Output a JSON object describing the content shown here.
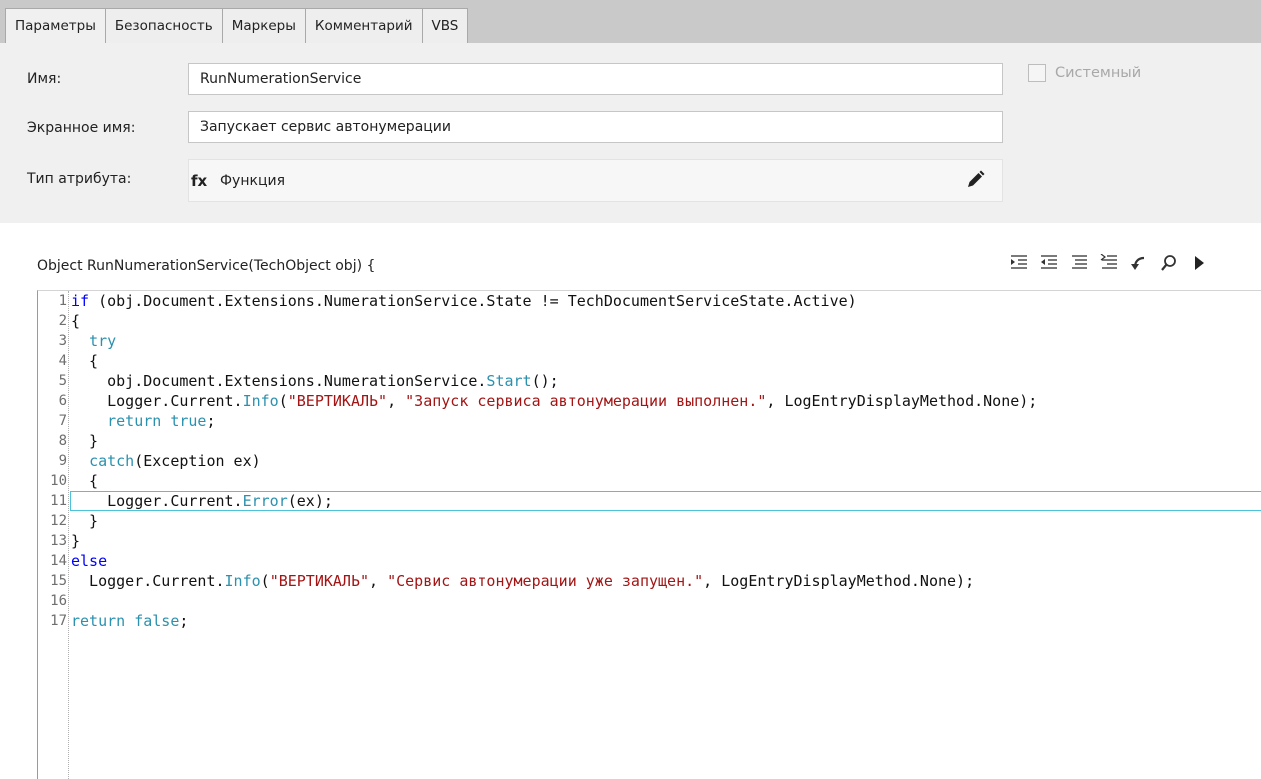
{
  "tabs": [
    {
      "label": "Параметры",
      "active": true
    },
    {
      "label": "Безопасность",
      "active": false
    },
    {
      "label": "Маркеры",
      "active": false
    },
    {
      "label": "Комментарий",
      "active": false
    },
    {
      "label": "VBS",
      "active": false
    }
  ],
  "form": {
    "name_label": "Имя:",
    "name_value": "RunNumerationService",
    "display_label": "Экранное имя:",
    "display_value": "Запускает сервис автонумерации",
    "type_label": "Тип атрибута:",
    "type_icon": "fx",
    "type_value": "Функция",
    "system_label": "Системный",
    "system_checked": false
  },
  "code": {
    "signature": "Object RunNumerationService(TechObject obj) {",
    "current_line": 9,
    "lines": [
      {
        "n": "1",
        "parts": [
          {
            "k": "kw",
            "t": "if"
          },
          {
            "k": "",
            "t": " (obj.Document.Extensions.NumerationService.State != TechDocumentServiceState.Active)"
          }
        ]
      },
      {
        "n": "2",
        "parts": [
          {
            "k": "",
            "t": "{"
          }
        ]
      },
      {
        "n": "3",
        "parts": [
          {
            "k": "",
            "t": "  "
          },
          {
            "k": "fn",
            "t": "try"
          }
        ]
      },
      {
        "n": "4",
        "parts": [
          {
            "k": "",
            "t": "  {"
          }
        ]
      },
      {
        "n": "5",
        "parts": [
          {
            "k": "",
            "t": "    obj.Document.Extensions.NumerationService."
          },
          {
            "k": "fn",
            "t": "Start"
          },
          {
            "k": "",
            "t": "();"
          }
        ]
      },
      {
        "n": "6",
        "parts": [
          {
            "k": "",
            "t": "    Logger.Current."
          },
          {
            "k": "fn",
            "t": "Info"
          },
          {
            "k": "",
            "t": "("
          },
          {
            "k": "st",
            "t": "\"ВЕРТИКАЛЬ\""
          },
          {
            "k": "",
            "t": ", "
          },
          {
            "k": "st",
            "t": "\"Запуск сервиса автонумерации выполнен.\""
          },
          {
            "k": "",
            "t": ", LogEntryDisplayMethod.None);"
          }
        ]
      },
      {
        "n": "7",
        "parts": [
          {
            "k": "",
            "t": "    "
          },
          {
            "k": "fn",
            "t": "return"
          },
          {
            "k": "",
            "t": " "
          },
          {
            "k": "fn",
            "t": "true"
          },
          {
            "k": "",
            "t": ";"
          }
        ]
      },
      {
        "n": "8",
        "parts": [
          {
            "k": "",
            "t": "  }"
          }
        ]
      },
      {
        "n": "9",
        "parts": [
          {
            "k": "",
            "t": "  "
          },
          {
            "k": "fn",
            "t": "catch"
          },
          {
            "k": "",
            "t": "(Exception ex)"
          }
        ]
      },
      {
        "n": "10",
        "parts": [
          {
            "k": "",
            "t": "  {"
          }
        ]
      },
      {
        "n": "11",
        "parts": [
          {
            "k": "",
            "t": "    Logger.Current."
          },
          {
            "k": "fn",
            "t": "Error"
          },
          {
            "k": "",
            "t": "(ex);"
          }
        ]
      },
      {
        "n": "12",
        "parts": [
          {
            "k": "",
            "t": "  }"
          }
        ]
      },
      {
        "n": "13",
        "parts": [
          {
            "k": "",
            "t": "}"
          }
        ]
      },
      {
        "n": "14",
        "parts": [
          {
            "k": "kw",
            "t": "else"
          }
        ]
      },
      {
        "n": "15",
        "parts": [
          {
            "k": "",
            "t": "  Logger.Current."
          },
          {
            "k": "fn",
            "t": "Info"
          },
          {
            "k": "",
            "t": "("
          },
          {
            "k": "st",
            "t": "\"ВЕРТИКАЛЬ\""
          },
          {
            "k": "",
            "t": ", "
          },
          {
            "k": "st",
            "t": "\"Сервис автонумерации уже запущен.\""
          },
          {
            "k": "",
            "t": ", LogEntryDisplayMethod.None);"
          }
        ]
      },
      {
        "n": "16",
        "parts": []
      },
      {
        "n": "17",
        "parts": [
          {
            "k": "fn",
            "t": "return"
          },
          {
            "k": "",
            "t": " "
          },
          {
            "k": "fn",
            "t": "false"
          },
          {
            "k": "",
            "t": ";"
          }
        ]
      }
    ]
  },
  "toolbar_icons": [
    "indent-icon",
    "outdent-icon",
    "comment-lines-icon",
    "uncomment-lines-icon",
    "undo-icon",
    "search-icon",
    "run-icon"
  ],
  "colors": {
    "keyword": "#0000ff",
    "identifier": "#2b91af",
    "string": "#a31515",
    "current_line_border": "#4cc3d9"
  }
}
